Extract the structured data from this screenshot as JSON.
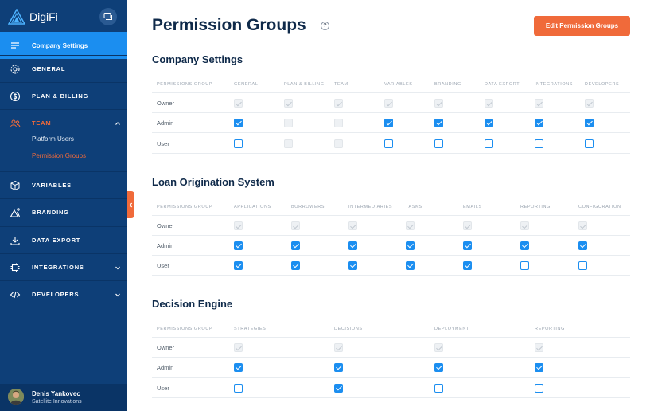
{
  "brand": {
    "name": "DigiFi"
  },
  "sidebar": {
    "items": [
      {
        "label": "Company Settings",
        "icon": "list-icon"
      },
      {
        "label": "GENERAL",
        "icon": "gear-icon"
      },
      {
        "label": "PLAN & BILLING",
        "icon": "dollar-icon"
      },
      {
        "label": "TEAM",
        "icon": "team-icon"
      },
      {
        "label": "VARIABLES",
        "icon": "cube-icon"
      },
      {
        "label": "BRANDING",
        "icon": "mountain-icon"
      },
      {
        "label": "DATA EXPORT",
        "icon": "download-icon"
      },
      {
        "label": "INTEGRATIONS",
        "icon": "chip-icon"
      },
      {
        "label": "DEVELOPERS",
        "icon": "code-icon"
      }
    ],
    "team_subitems": [
      "Platform Users",
      "Permission Groups"
    ]
  },
  "user": {
    "name": "Denis Yankovec",
    "org": "Satellite Innovations"
  },
  "page": {
    "title": "Permission Groups",
    "help": "?",
    "edit_button": "Edit Permission Groups"
  },
  "accent_color": "#f06a3a",
  "checkbox_color": "#1b8ef0",
  "sections": [
    {
      "title": "Company Settings",
      "first_header": "Permissions Group",
      "columns": [
        "General",
        "Plan & Billing",
        "Team",
        "Variables",
        "Branding",
        "Data Export",
        "Integrations",
        "Developers"
      ],
      "rows": [
        {
          "label": "Owner",
          "states": [
            "dc",
            "dc",
            "dc",
            "dc",
            "dc",
            "dc",
            "dc",
            "dc"
          ]
        },
        {
          "label": "Admin",
          "states": [
            "c",
            "d",
            "d",
            "c",
            "c",
            "c",
            "c",
            "c"
          ]
        },
        {
          "label": "User",
          "states": [
            "e",
            "d",
            "d",
            "e",
            "e",
            "e",
            "e",
            "e"
          ]
        }
      ]
    },
    {
      "title": "Loan Origination System",
      "first_header": "Permissions Group",
      "columns": [
        "Applications",
        "Borrowers",
        "Intermediaries",
        "Tasks",
        "Emails",
        "Reporting",
        "Configuration"
      ],
      "rows": [
        {
          "label": "Owner",
          "states": [
            "dc",
            "dc",
            "dc",
            "dc",
            "dc",
            "dc",
            "dc"
          ]
        },
        {
          "label": "Admin",
          "states": [
            "c",
            "c",
            "c",
            "c",
            "c",
            "c",
            "c"
          ]
        },
        {
          "label": "User",
          "states": [
            "c",
            "c",
            "c",
            "c",
            "c",
            "e",
            "e"
          ]
        }
      ]
    },
    {
      "title": "Decision Engine",
      "first_header": "Permissions Group",
      "columns": [
        "Strategies",
        "Decisions",
        "Deployment",
        "Reporting"
      ],
      "rows": [
        {
          "label": "Owner",
          "states": [
            "dc",
            "dc",
            "dc",
            "dc"
          ]
        },
        {
          "label": "Admin",
          "states": [
            "c",
            "c",
            "c",
            "c"
          ]
        },
        {
          "label": "User",
          "states": [
            "e",
            "c",
            "e",
            "e"
          ]
        }
      ]
    }
  ]
}
